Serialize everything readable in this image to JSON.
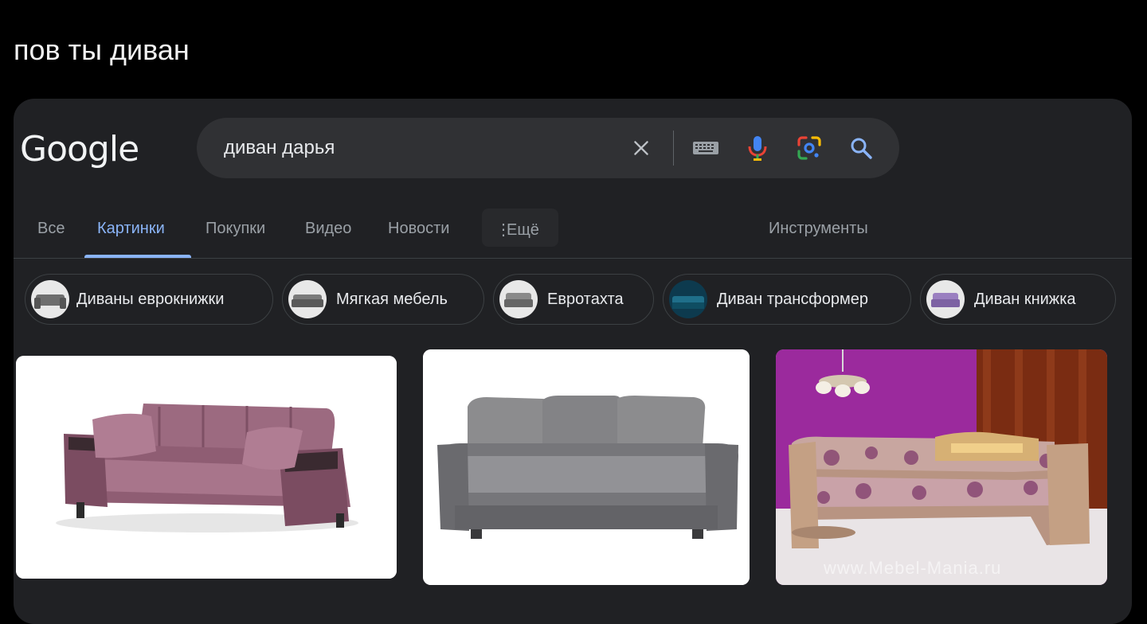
{
  "post": {
    "caption": "пов ты диван"
  },
  "google": {
    "logo": "Google",
    "search": {
      "query": "диван дарья"
    },
    "icons": [
      "close-icon",
      "keyboard-icon",
      "mic-icon",
      "lens-icon",
      "search-icon"
    ],
    "tabs": [
      {
        "label": "Все"
      },
      {
        "label": "Картинки",
        "active": true
      },
      {
        "label": "Покупки"
      },
      {
        "label": "Видео"
      },
      {
        "label": "Новости"
      },
      {
        "label": "Ещё"
      }
    ],
    "tools_label": "Инструменты",
    "chips": [
      {
        "label": "Диваны еврокнижки"
      },
      {
        "label": "Мягкая мебель"
      },
      {
        "label": "Евротахта"
      },
      {
        "label": "Диван трансформер"
      },
      {
        "label": "Диван книжка"
      }
    ],
    "results": [
      {
        "image": "pink-sofa-image"
      },
      {
        "image": "grey-sofa-image"
      },
      {
        "image": "corner-sofa-image",
        "watermark": "www.Mebel-Mania.ru"
      }
    ],
    "colors": {
      "background": "#202124",
      "search_box": "#303134",
      "active_tab": "#8ab4f8",
      "inactive_tab": "#9aa0a6"
    }
  }
}
